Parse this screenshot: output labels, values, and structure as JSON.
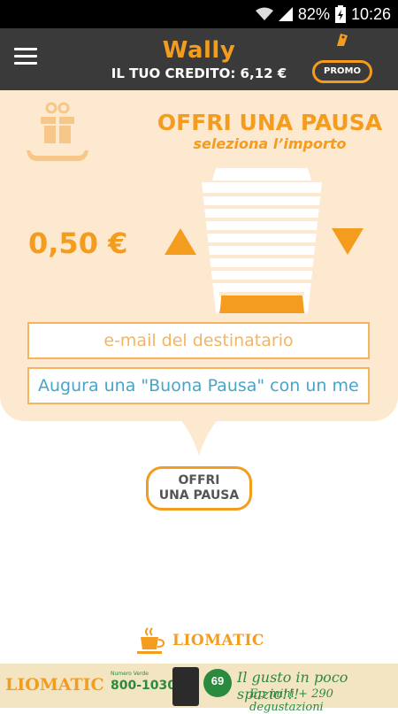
{
  "status_bar": {
    "battery": "82%",
    "time": "10:26"
  },
  "header": {
    "title": "Wally",
    "credit": "IL TUO CREDITO: 6,12 €",
    "promo_label": "PROMO"
  },
  "offer": {
    "title": "OFFRI UNA PAUSA",
    "subtitle": "seleziona l’importo",
    "amount": "0,50 €",
    "email_placeholder": "e-mail del destinatario",
    "message_placeholder": "Augura una \"Buona Pausa\" con un mes",
    "button_line1": "OFFRI",
    "button_line2": "UNA PAUSA"
  },
  "footer": {
    "logo_text": "LIOMATIC"
  },
  "banner": {
    "brand": "LIOMATIC",
    "phone_label": "Numero Verde",
    "phone": "800-103010",
    "badge_number": "69",
    "tagline1": "Il gusto in poco spazio!!!",
    "tagline2": "Ep mini + 290 degustazioni"
  },
  "colors": {
    "accent": "#f39c1e",
    "header_bg": "#3a3a3a",
    "panel_bg": "#fde9cf",
    "field_border": "#f5b460",
    "placeholder_blue": "#4aa4c8"
  }
}
